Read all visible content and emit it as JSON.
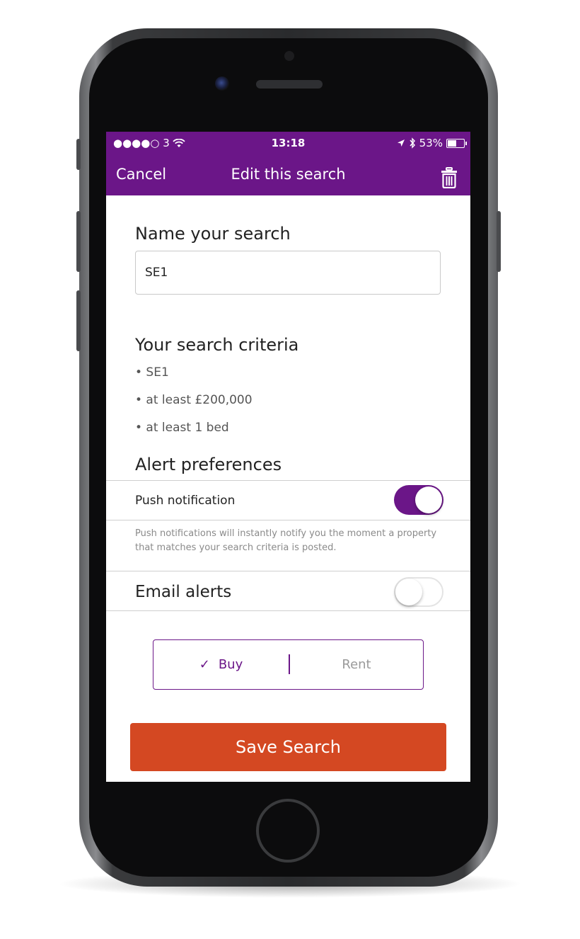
{
  "status_bar": {
    "carrier": "●●●●○ 3",
    "time": "13:18",
    "battery": "53%",
    "battery_level": 0.53
  },
  "nav": {
    "cancel": "Cancel",
    "title": "Edit this search",
    "delete_icon": "trash-icon"
  },
  "name_section": {
    "heading": "Name your search",
    "value": "SE1"
  },
  "criteria": {
    "heading": "Your search criteria",
    "items": [
      "• SE1",
      "• at least £200,000",
      "• at least 1 bed"
    ]
  },
  "alerts": {
    "heading": "Alert preferences",
    "push_label": "Push notification",
    "push_enabled": true,
    "push_help": "Push notifications will instantly notify you the moment a property that matches your search criteria is posted.",
    "email_label": "Email alerts",
    "email_enabled": false
  },
  "segment": {
    "check": "✓",
    "buy": "Buy",
    "rent": "Rent",
    "selected": "Buy"
  },
  "save_button": "Save Search",
  "colors": {
    "brand_purple": "#6b1688",
    "save_orange": "#d44822"
  }
}
